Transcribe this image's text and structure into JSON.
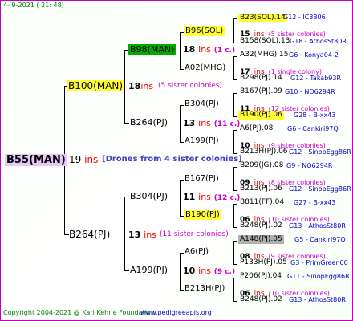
{
  "date": "4- 9-2021 ( 21: 48)",
  "root": {
    "name": "B55(MAN)",
    "ins": "19",
    "ins_label": "ins",
    "drones": "[Drones from 4 sister colonies]"
  },
  "gen1": [
    {
      "name": "B100(MAN)",
      "ins": "18",
      "ins_label": "ins",
      "sisters": "(5 sister colonies)"
    },
    {
      "name": "B264(PJ)",
      "ins": "13",
      "ins_label": "ins",
      "sisters": "(11 sister colonies)"
    }
  ],
  "gen2": [
    {
      "name": "B98(MAN)",
      "ins": "18",
      "ins_label": "ins",
      "sisters": "(1 c.)"
    },
    {
      "name": "B264(PJ)",
      "ins": "13",
      "ins_label": "ins",
      "sisters": "(11 c.)"
    },
    {
      "name": "B304(PJ)",
      "ins": "11",
      "ins_label": "ins",
      "sisters": "(12 c.)"
    },
    {
      "name": "A199(PJ)",
      "ins": "10",
      "ins_label": "ins",
      "sisters": "(9 c.)"
    }
  ],
  "gen3": [
    {
      "name": "B96(SOL)"
    },
    {
      "name": "A02(MHG)"
    },
    {
      "name": "B304(PJ)"
    },
    {
      "name": "A199(PJ)"
    },
    {
      "name": "B167(PJ)"
    },
    {
      "name": "B190(PJ)"
    },
    {
      "name": "A6(PJ)"
    },
    {
      "name": "B213H(PJ)"
    }
  ],
  "gen4": [
    {
      "top": "B23(SOL).14",
      "top_info": "G12 - IC8806",
      "ins": "15",
      "sisters": "(5 sister colonies)",
      "bottom": "B158(SOL).13",
      "bottom_info": "G18 - AthosSt80R"
    },
    {
      "top": "A32(MHG).15",
      "top_info": "G6 - Konya04-2",
      "ins": "17",
      "sisters": "(1 single colony)",
      "bottom": "B298(PJ).14",
      "bottom_info": "G12 - Takab93R"
    },
    {
      "top": "B167(PJ).09",
      "top_info": "G10 - NO6294R",
      "ins": "11",
      "sisters": "(12 sister colonies)",
      "bottom": "B190(PJ).06",
      "bottom_info": "G28 - B-xx43"
    },
    {
      "top": "A6(PJ).08",
      "top_info": "G6 - Cankiri97Q",
      "ins": "10",
      "sisters": "(9 sister colonies)",
      "bottom": "B213H(PJ).06",
      "bottom_info": "G12 - SinopEgg86R"
    },
    {
      "top": "B209(JG).08",
      "top_info": "G9 - NO6294R",
      "ins": "09",
      "sisters": "(8 sister colonies)",
      "bottom": "B213(PJ).06",
      "bottom_info": "G12 - SinopEgg86R"
    },
    {
      "top": "B811(FF).04",
      "top_info": "G27 - B-xx43",
      "ins": "06",
      "sisters": "(10 sister colonies)",
      "bottom": "B248(PJ).02",
      "bottom_info": "G13 - AthosSt80R"
    },
    {
      "top": "A148(PJ).05",
      "top_info": "G5 - Cankiri97Q",
      "ins": "08",
      "sisters": "(9 sister colonies)",
      "bottom": "P133H(PJ).05",
      "bottom_info": "G3 - PrimGreen00"
    },
    {
      "top": "P206(PJ).04",
      "top_info": "G11 - SinopEgg86R",
      "ins": "06",
      "sisters": "(10 sister colonies)",
      "bottom": "B248(PJ).02",
      "bottom_info": "G13 - AthosSt80R"
    }
  ],
  "copyright": "Copyright 2004-2021 @ Karl Kehrle Foundation",
  "url": "www.pedigreeapis.org"
}
